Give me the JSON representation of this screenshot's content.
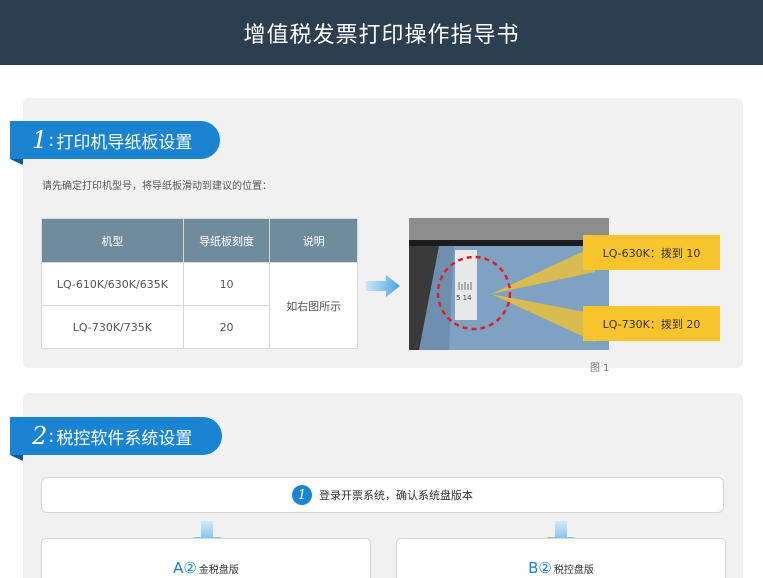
{
  "header": {
    "title": "增值税发票打印操作指导书"
  },
  "section1": {
    "number": "1",
    "colon": ":",
    "title": "打印机导纸板设置",
    "instruction": "请先确定打印机型号，将导纸板滑动到建议的位置：",
    "table": {
      "headers": [
        "机型",
        "导纸板刻度",
        "说明"
      ],
      "rows": [
        {
          "model": "LQ-610K/630K/635K",
          "scale": "10"
        },
        {
          "model": "LQ-730K/735K",
          "scale": "20"
        }
      ],
      "note": "如右图所示"
    },
    "callouts": [
      "LQ-630K：拨到 10",
      "LQ-730K：拨到 20"
    ],
    "figure_caption": "图 1"
  },
  "section2": {
    "number": "2",
    "colon": ":",
    "title": "税控软件系统设置",
    "step1": {
      "num": "1",
      "text": "登录开票系统，确认系统盘版本"
    },
    "option_a": {
      "letter": "A",
      "circle": "②",
      "label": "金税盘版"
    },
    "option_b": {
      "letter": "B",
      "circle": "②",
      "label": "税控盘版"
    }
  },
  "colors": {
    "header_bg": "#2c3e50",
    "accent_blue": "#1b84d2",
    "callout_yellow": "#f8c42e",
    "table_header": "#6e8c9c"
  }
}
